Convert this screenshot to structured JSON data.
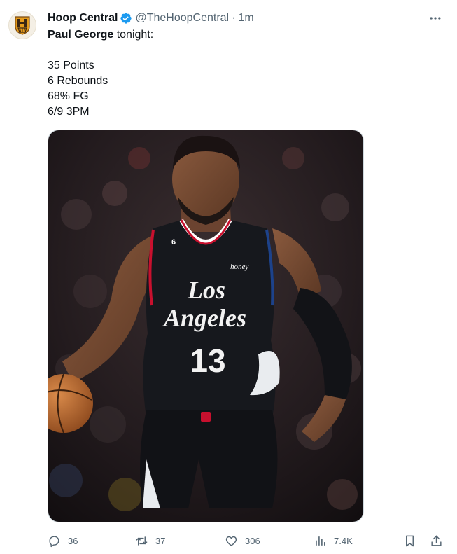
{
  "tweet": {
    "author": {
      "display_name": "Hoop Central",
      "handle": "@TheHoopCentral",
      "separator": "·",
      "time": "1m",
      "verified": true,
      "avatar_icon": "hoop-central-logo"
    },
    "text": {
      "name": "Paul George",
      "intro": " tonight:",
      "stats": [
        "35 Points",
        "6 Rebounds",
        "68% FG",
        "6/9 3PM"
      ]
    },
    "media": {
      "type": "photo",
      "jersey_city_line1": "Los",
      "jersey_city_line2": "Angeles",
      "jersey_number": "13",
      "jersey_small_number": "6",
      "jersey_patch": "honey",
      "colors": {
        "jersey": "#16181d",
        "trim_red": "#c8102e",
        "trim_blue": "#1d428a",
        "background": "#2b2225"
      }
    },
    "actions": {
      "replies": "36",
      "reposts": "37",
      "likes": "306",
      "views": "7.4K"
    },
    "icons": {
      "reply": "reply-icon",
      "repost": "repost-icon",
      "like": "like-icon",
      "views": "views-icon",
      "bookmark": "bookmark-icon",
      "share": "share-icon",
      "more": "more-icon",
      "verified": "verified-badge-icon"
    },
    "colors": {
      "text": "#0f1419",
      "secondary": "#536471",
      "verified": "#1d9bf0"
    }
  }
}
